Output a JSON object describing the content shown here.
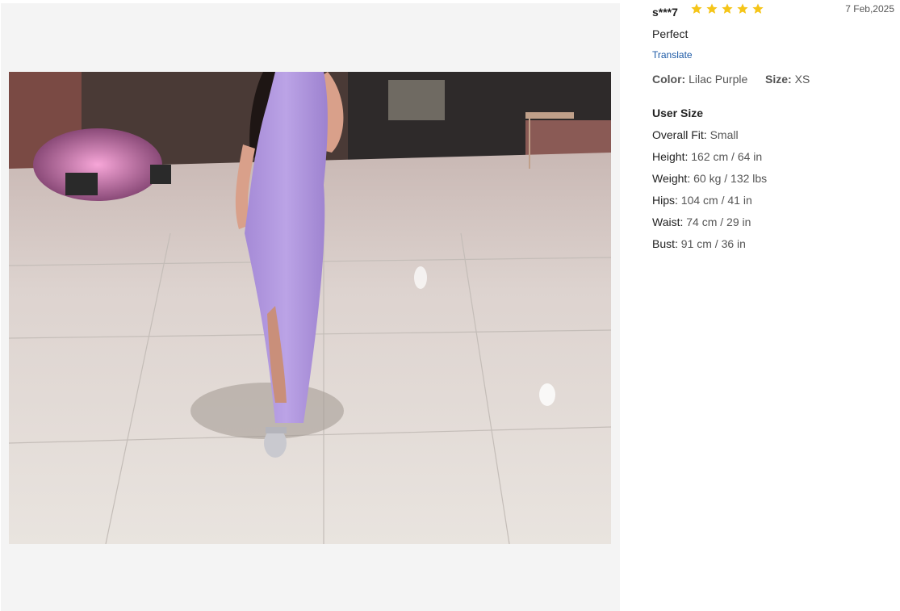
{
  "review": {
    "reviewer": "s***7",
    "rating": 5,
    "date": "7 Feb,2025",
    "text": "Perfect",
    "translate_label": "Translate",
    "color_label": "Color:",
    "color_value": "Lilac Purple",
    "size_label": "Size:",
    "size_value": "XS",
    "star_color": "#f5c518"
  },
  "user_size": {
    "title": "User Size",
    "rows": [
      {
        "label": "Overall Fit:",
        "value": "Small"
      },
      {
        "label": "Height:",
        "value": "162 cm / 64 in"
      },
      {
        "label": "Weight:",
        "value": "60 kg / 132 lbs"
      },
      {
        "label": "Hips:",
        "value": "104 cm / 41 in"
      },
      {
        "label": "Waist:",
        "value": "74 cm / 29 in"
      },
      {
        "label": "Bust:",
        "value": "91 cm / 36 in"
      }
    ]
  },
  "photo": {
    "subject": "customer-photo-lilac-dress"
  }
}
